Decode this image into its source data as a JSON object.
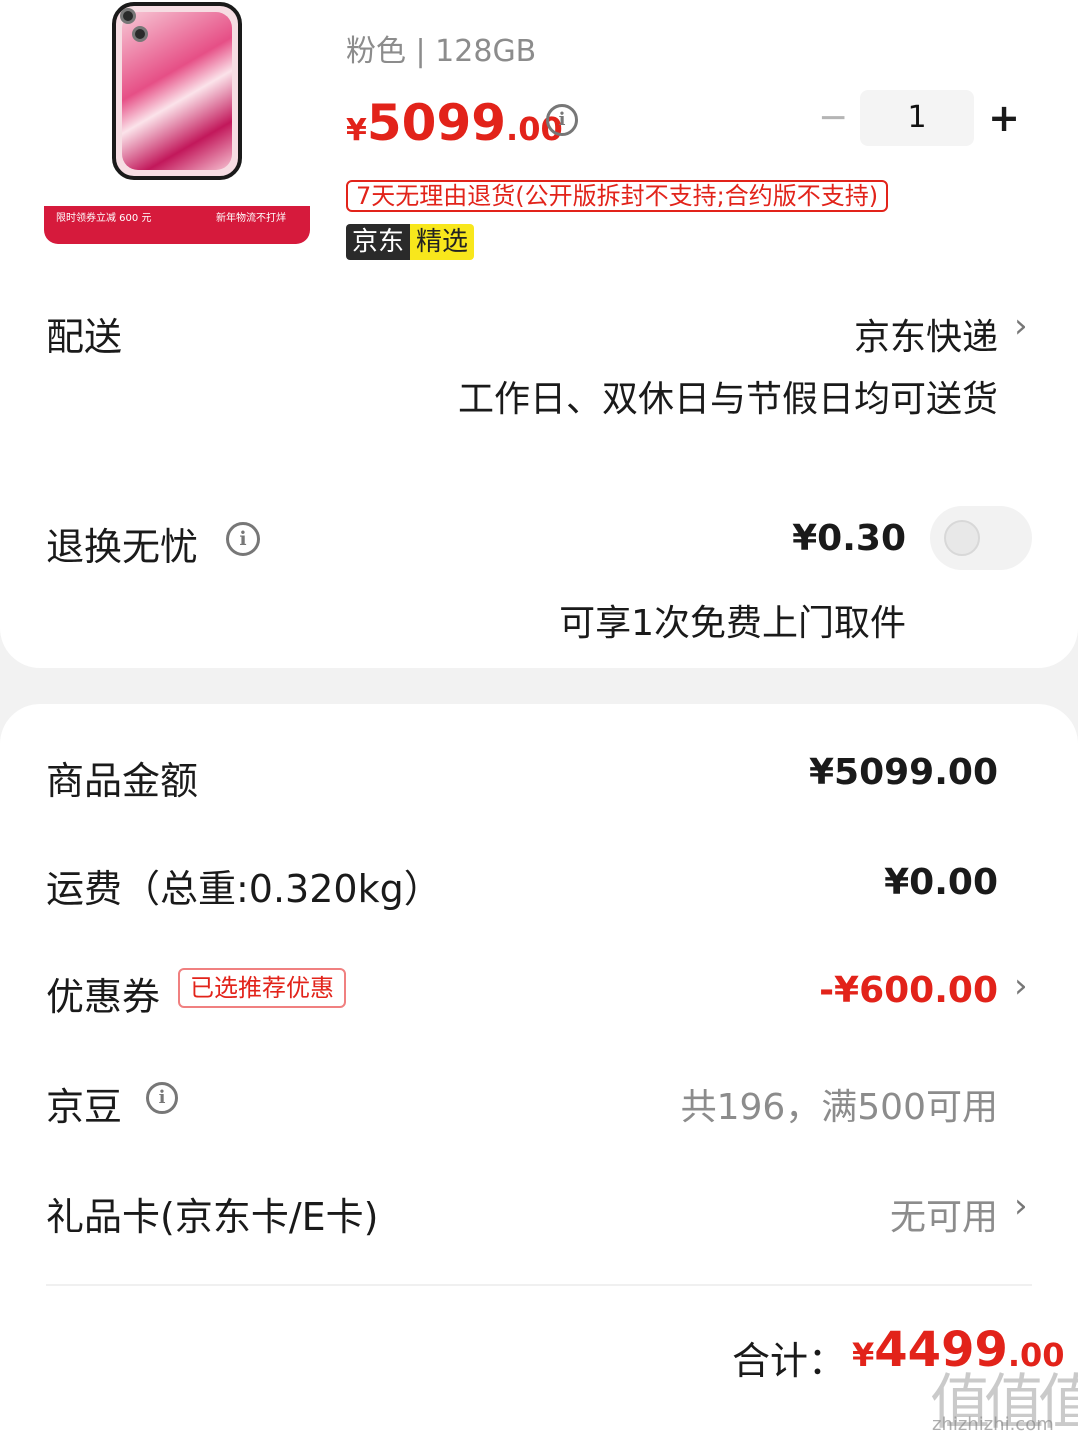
{
  "product": {
    "variant": "粉色 | 128GB",
    "price_symbol": "¥",
    "price_int": "5099",
    "price_dec": ".00",
    "info_glyph": "i",
    "quantity": "1",
    "minus_glyph": "−",
    "plus_glyph": "+",
    "image_banner_left": "限时领券立减 600 元",
    "image_banner_right": "新年物流不打烊",
    "return_tag": "7天无理由退货(公开版拆封不支持;合约版不支持)",
    "jd_tag_a": "京东",
    "jd_tag_b": "精选",
    "accent_color": "#e2231a"
  },
  "delivery": {
    "label": "配送",
    "method": "京东快递",
    "note": "工作日、双休日与节假日均可送货"
  },
  "return_service": {
    "label": "退换无忧",
    "price": "¥0.30",
    "note": "可享1次免费上门取件",
    "toggle_on": false
  },
  "summary": {
    "goods_label": "商品金额",
    "goods_value": "¥5099.00",
    "shipping_label": "运费（总重:0.320kg）",
    "shipping_value": "¥0.00",
    "coupon_label": "优惠券",
    "coupon_tag": "已选推荐优惠",
    "coupon_value": "-¥600.00",
    "beans_label": "京豆",
    "beans_value": "共196，满500可用",
    "giftcard_label": "礼品卡(京东卡/E卡)",
    "giftcard_value": "无可用",
    "chevron": "›",
    "total_label": "合计：",
    "total_symbol": "¥",
    "total_int": "4499",
    "total_dec": ".00"
  },
  "watermark": {
    "glyphs": "值值值",
    "url": "zhizhizhi.com"
  }
}
